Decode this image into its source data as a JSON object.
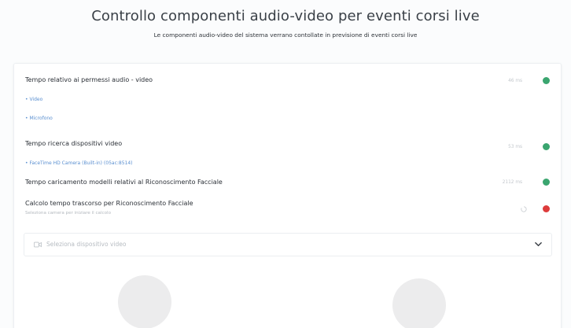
{
  "header": {
    "title": "Controllo componenti audio-video per eventi corsi live",
    "subtitle": "Le componenti audio-video del sistema verrano contollate in previsione di eventi corsi live"
  },
  "checks": [
    {
      "title": "Tempo relativo ai permessi audio - video",
      "time": "46 ms",
      "status_color": "#3aa56f",
      "items": [
        "• Video",
        "• Microfono"
      ]
    },
    {
      "title": "Tempo ricerca dispositivi video",
      "time": "53 ms",
      "status_color": "#3aa56f",
      "items": [
        "• FaceTime HD Camera (Built-in) (05ac:8514)"
      ]
    },
    {
      "title": "Tempo caricamento modelli relativi al Riconoscimento Facciale",
      "time": "2112 ms",
      "status_color": "#3aa56f",
      "items": []
    },
    {
      "title": "Calcolo tempo trascorso per Riconoscimento Facciale",
      "description": "Seleziona camera per iniziare il calcolo",
      "time": "",
      "status_color": "#dd3b3b",
      "items": []
    }
  ],
  "video_select": {
    "placeholder": "Seleziona dispositivo video",
    "icon": "video-camera-icon"
  },
  "colors": {
    "success": "#3aa56f",
    "error": "#dd3b3b",
    "link": "#5a8fd0"
  }
}
